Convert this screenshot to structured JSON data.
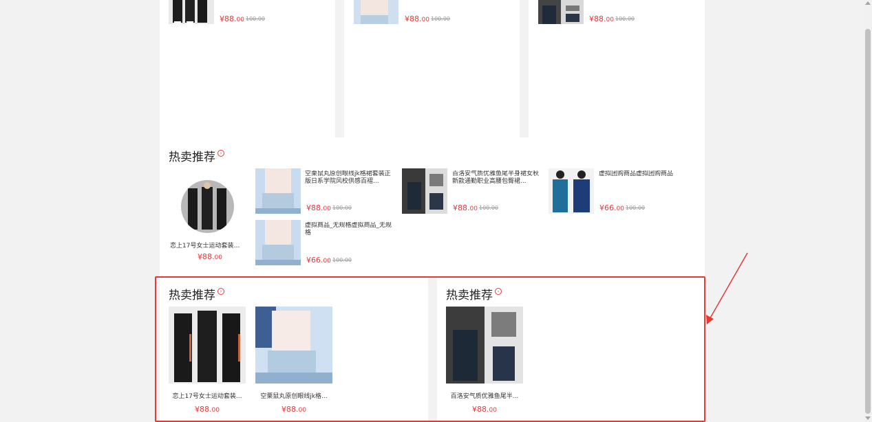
{
  "colors": {
    "accent": "#e4393c",
    "highlight": "#e53935",
    "page_bg": "#f2f2f2"
  },
  "top_row": [
    {
      "price_int": "¥88.",
      "price_dec": "00",
      "old_price": "100.00"
    },
    {
      "price_int": "¥88.",
      "price_dec": "00",
      "old_price": "100.00"
    },
    {
      "price_int": "¥88.",
      "price_dec": "00",
      "old_price": "100.00"
    }
  ],
  "hot_section_1": {
    "title": "热卖推荐",
    "icon": "chevron-right-circle-icon",
    "feature": {
      "title": "恋上17号女士运动套装女...",
      "price_int": "¥88.",
      "price_dec": "00"
    },
    "items": [
      {
        "title": "空栗鼠丸原创眼线jk格裙套装正版日系学院风校供感百褶...",
        "price_int": "¥88.",
        "price_dec": "00",
        "old_price": "100.00"
      },
      {
        "title": "百洛安气质优雅鱼尾半身裙女秋新款通勤职业高腰包臀裙...",
        "price_int": "¥88.",
        "price_dec": "00",
        "old_price": "100.00"
      },
      {
        "title": "虚拟团购商品虚拟团购商品",
        "price_int": "¥66.",
        "price_dec": "00",
        "old_price": "100.00"
      },
      {
        "title": "虚拟商品_无规格虚拟商品_无规格",
        "price_int": "¥66.",
        "price_dec": "00",
        "old_price": "100.00"
      }
    ]
  },
  "hot_section_left": {
    "title": "热卖推荐",
    "items": [
      {
        "title": "恋上17号女士运动套装...",
        "price_int": "¥88.",
        "price_dec": "00"
      },
      {
        "title": "空栗鼠丸原创眼线jk格...",
        "price_int": "¥88.",
        "price_dec": "00"
      }
    ]
  },
  "hot_section_right": {
    "title": "热卖推荐",
    "items": [
      {
        "title": "百洛安气质优雅鱼尾半...",
        "price_int": "¥88.",
        "price_dec": "00"
      }
    ]
  }
}
